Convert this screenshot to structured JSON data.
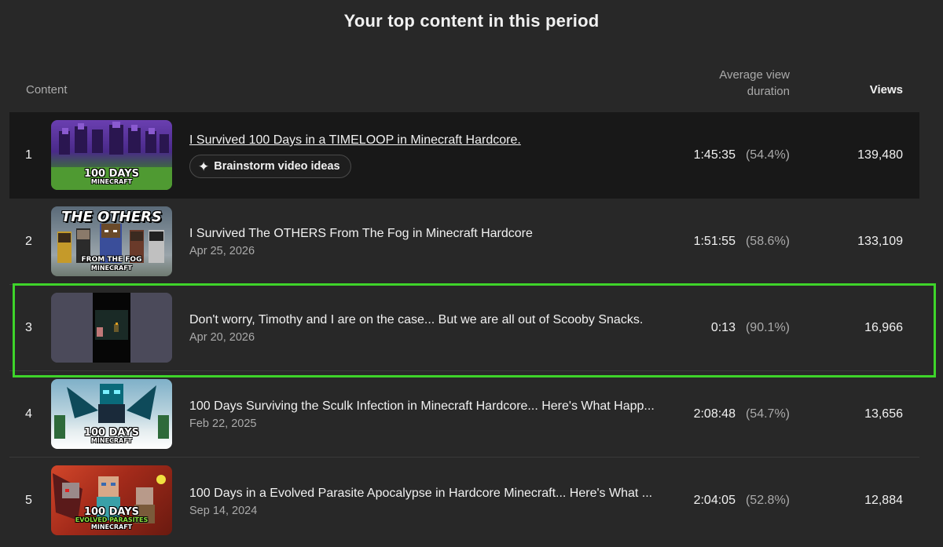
{
  "section_title": "Your top content in this period",
  "columns": {
    "content": "Content",
    "avg_view_duration": "Average view duration",
    "views": "Views"
  },
  "rows": [
    {
      "rank": "1",
      "title": "I Survived 100 Days in a TIMELOOP in Minecraft Hardcore.",
      "date": "",
      "action": "Brainstorm video ideas",
      "duration": "1:45:35",
      "percent": "(54.4%)",
      "views": "139,480",
      "thumb_text": "100 DAYS",
      "thumb_sub": "MINECRAFT",
      "thumb_icon": "minecraft-thumbnail"
    },
    {
      "rank": "2",
      "title": "I Survived The OTHERS From The Fog in Minecraft Hardcore",
      "date": "Apr 25, 2026",
      "duration": "1:51:55",
      "percent": "(58.6%)",
      "views": "133,109",
      "thumb_top": "THE OTHERS",
      "thumb_text": "FROM THE FOG",
      "thumb_sub": "MINECRAFT",
      "thumb_icon": "minecraft-thumbnail"
    },
    {
      "rank": "3",
      "title": "Don't worry, Timothy and I are on the case... But we are all out of Scooby Snacks.",
      "date": "Apr 20, 2026",
      "duration": "0:13",
      "percent": "(90.1%)",
      "views": "16,966",
      "thumb_icon": "short-video-thumbnail"
    },
    {
      "rank": "4",
      "title": "100 Days Surviving the Sculk Infection in Minecraft Hardcore... Here's What Happ...",
      "date": "Feb 22, 2025",
      "duration": "2:08:48",
      "percent": "(54.7%)",
      "views": "13,656",
      "thumb_text": "100 DAYS",
      "thumb_sub": "MINECRAFT",
      "thumb_icon": "minecraft-thumbnail"
    },
    {
      "rank": "5",
      "title": "100 Days in a Evolved Parasite Apocalypse in Hardcore Minecraft... Here's What ...",
      "date": "Sep 14, 2024",
      "duration": "2:04:05",
      "percent": "(52.8%)",
      "views": "12,884",
      "thumb_text": "100 DAYS",
      "thumb_mid": "EVOLVED PARASITES",
      "thumb_sub": "MINECRAFT",
      "thumb_icon": "minecraft-thumbnail"
    }
  ],
  "colors": {
    "background": "#282828",
    "active_row": "#181818",
    "highlight": "#3ed42a",
    "text_primary": "#f1f1f1",
    "text_secondary": "#aaaaaa"
  }
}
